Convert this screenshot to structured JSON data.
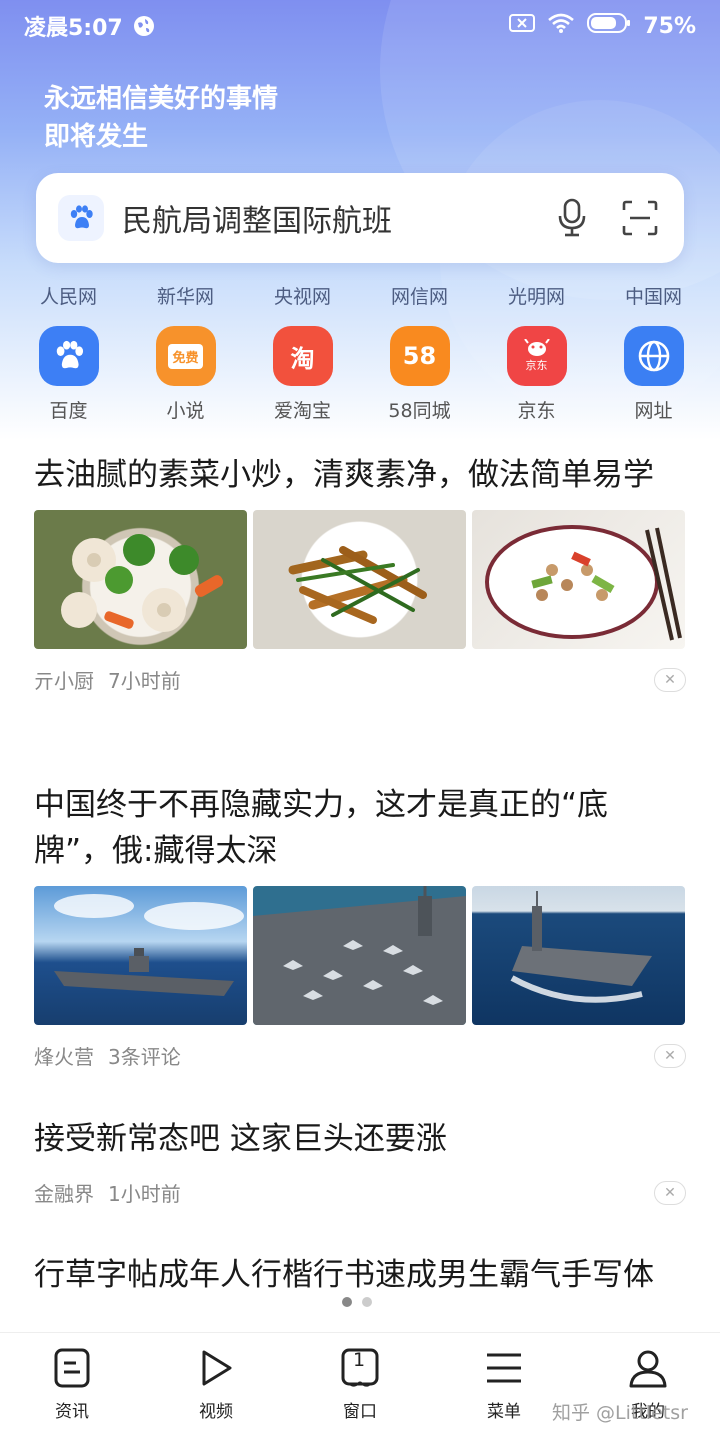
{
  "status_bar": {
    "time": "凌晨5:07",
    "battery": "75%"
  },
  "header": {
    "slogan_line1": "永远相信美好的事情",
    "slogan_line2": "即将发生",
    "search_query": "民航局调整国际航班"
  },
  "news_links": [
    {
      "label": "人民网"
    },
    {
      "label": "新华网"
    },
    {
      "label": "央视网"
    },
    {
      "label": "网信网"
    },
    {
      "label": "光明网"
    },
    {
      "label": "中国网"
    }
  ],
  "shortcuts": [
    {
      "label": "百度",
      "icon": "baidu-paw-icon",
      "color": "#3d7ff5"
    },
    {
      "label": "小说",
      "icon": "novel-icon",
      "color": "#f7922b",
      "badge": "免费"
    },
    {
      "label": "爱淘宝",
      "icon": "taobao-icon",
      "color": "#f2513d",
      "badge": "淘"
    },
    {
      "label": "58同城",
      "icon": "58-icon",
      "color": "#f98a1f",
      "badge": "58"
    },
    {
      "label": "京东",
      "icon": "jd-icon",
      "color": "#f04545",
      "badge": "京东"
    },
    {
      "label": "网址",
      "icon": "globe-icon",
      "color": "#3b7ff3"
    }
  ],
  "feed": [
    {
      "title": "去油腻的素菜小炒，清爽素净，做法简单易学",
      "source": "亓小厨",
      "info": "7小时前",
      "images": [
        "lotus-root-vegetables-dish",
        "stir-fried-yuba-chives-dish",
        "mushroom-cucumber-dish"
      ]
    },
    {
      "title": "中国终于不再隐藏实力，这才是真正的“底牌”，俄:藏得太深",
      "source": "烽火营",
      "info": "3条评论",
      "images": [
        "aircraft-carrier-at-sea",
        "aircraft-carrier-deck",
        "aircraft-carrier-wake"
      ]
    },
    {
      "title": "接受新常态吧 这家巨头还要涨",
      "source": "金融界",
      "info": "1小时前",
      "images": []
    },
    {
      "title": "行草字帖成年人行楷行书速成男生霸气手写体",
      "source": "",
      "info": "",
      "images": []
    }
  ],
  "bottom_nav": [
    {
      "label": "资讯",
      "icon": "news-icon"
    },
    {
      "label": "视频",
      "icon": "play-icon"
    },
    {
      "label": "窗口",
      "icon": "window-icon",
      "count": "1"
    },
    {
      "label": "菜单",
      "icon": "menu-icon"
    },
    {
      "label": "我的",
      "icon": "user-icon"
    }
  ],
  "watermark": "知乎 @Littletsr"
}
